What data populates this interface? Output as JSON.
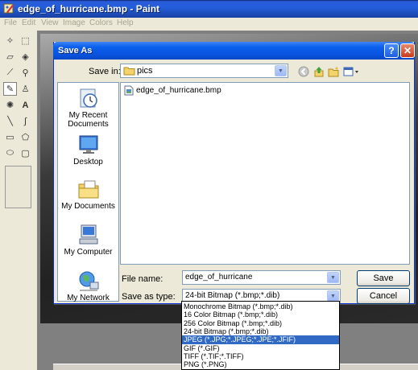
{
  "window": {
    "title": "edge_of_hurricane.bmp - Paint"
  },
  "menu": [
    "File",
    "Edit",
    "View",
    "Image",
    "Colors",
    "Help"
  ],
  "toolbox": {
    "tools": [
      "free-form-select-icon",
      "select-icon",
      "eraser-icon",
      "fill-icon",
      "color-picker-icon",
      "magnifier-icon",
      "pencil-icon",
      "brush-icon",
      "airbrush-icon",
      "text-icon",
      "line-icon",
      "curve-icon",
      "rectangle-icon",
      "polygon-icon",
      "ellipse-icon",
      "rounded-rectangle-icon"
    ],
    "selected": "pencil-icon"
  },
  "dialog": {
    "title": "Save As",
    "help_glyph": "?",
    "close_glyph": "✕",
    "save_in_label": "Save in:",
    "save_in_value": "pics",
    "places": [
      {
        "label": "My Recent Documents",
        "icon": "recent-documents-icon"
      },
      {
        "label": "Desktop",
        "icon": "desktop-icon"
      },
      {
        "label": "My Documents",
        "icon": "my-documents-icon"
      },
      {
        "label": "My Computer",
        "icon": "my-computer-icon"
      },
      {
        "label": "My Network",
        "icon": "my-network-icon"
      }
    ],
    "files": [
      {
        "name": "edge_of_hurricane.bmp",
        "icon": "bitmap-file-icon"
      }
    ],
    "file_name_label": "File name:",
    "file_name_value": "edge_of_hurricane",
    "file_type_label": "Save as type:",
    "file_type_value": "24-bit Bitmap (*.bmp;*.dib)",
    "save_label": "Save",
    "cancel_label": "Cancel",
    "type_options": [
      "Monochrome Bitmap (*.bmp;*.dib)",
      "16 Color Bitmap (*.bmp;*.dib)",
      "256 Color Bitmap (*.bmp;*.dib)",
      "24-bit Bitmap (*.bmp;*.dib)",
      "JPEG (*.JPG;*.JPEG;*.JPE;*.JFIF)",
      "GIF (*.GIF)",
      "TIFF (*.TIF;*.TIFF)",
      "PNG (*.PNG)"
    ],
    "selected_type_index": 4
  },
  "colors": {
    "titlebar": "#0A5FEC",
    "selection": "#316AC5",
    "close": "#C9391B"
  }
}
